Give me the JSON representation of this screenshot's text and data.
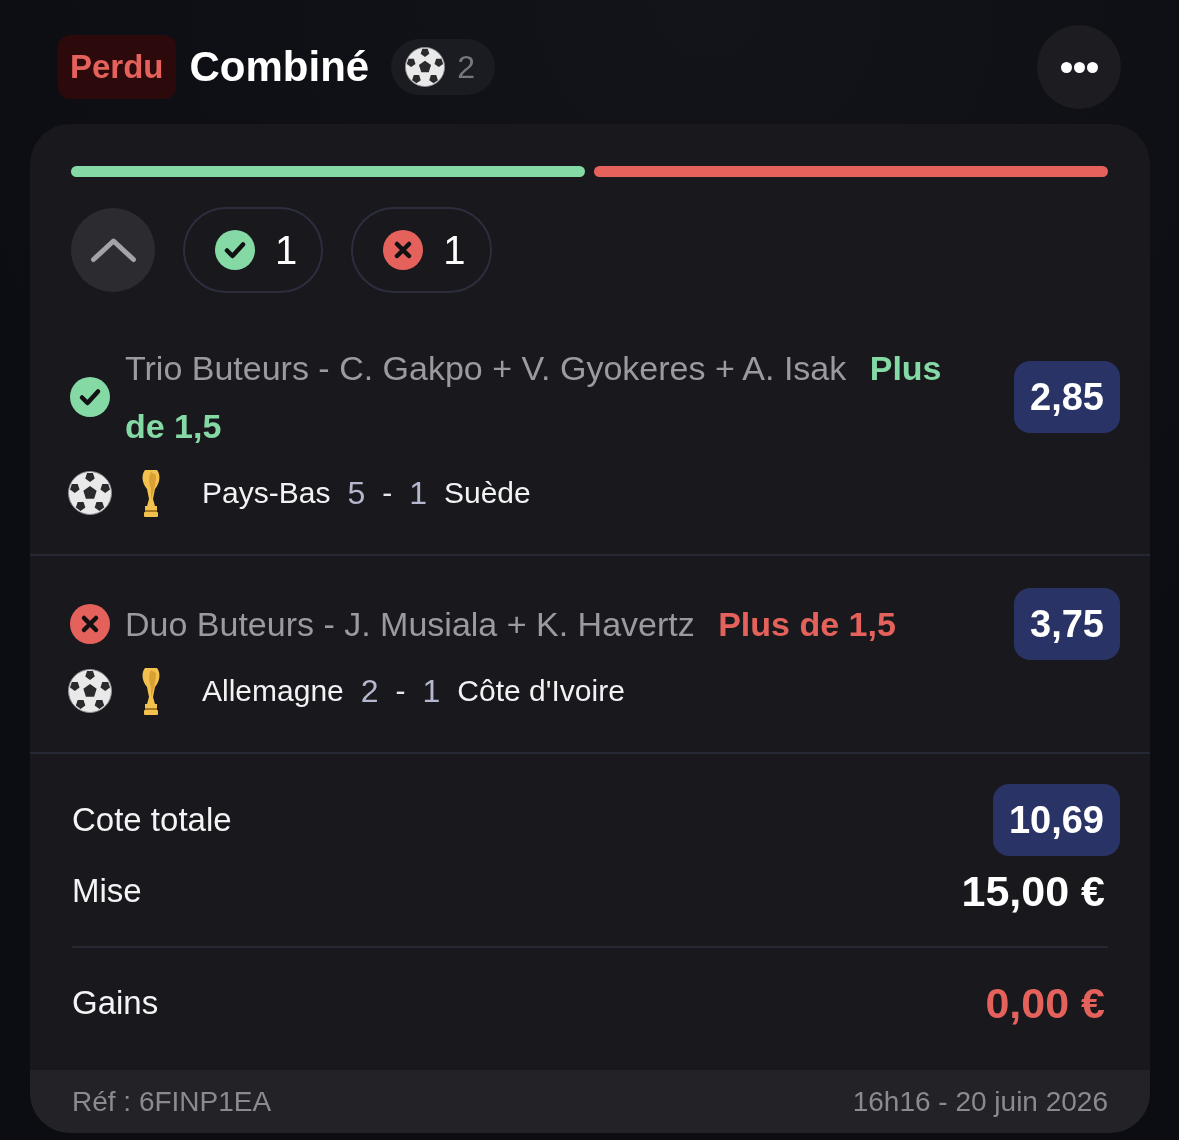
{
  "header": {
    "status": {
      "label": "Perdu",
      "kind": "lost"
    },
    "title": "Combiné",
    "sport_count": "2"
  },
  "filter_bar": {
    "expanded": true,
    "chips": [
      {
        "kind": "won",
        "count": "1"
      },
      {
        "kind": "lost",
        "count": "1"
      }
    ]
  },
  "selections": [
    {
      "kind": "won",
      "market": "Trio Buteurs - C. Gakpo + V. Gyokeres + A. Isak",
      "pick": "Plus de 1,5",
      "odds": "2,85",
      "match": {
        "home": "Pays-Bas",
        "home_score": "5",
        "separator": "-",
        "away_score": "1",
        "away": "Suède"
      }
    },
    {
      "kind": "lost",
      "market": "Duo Buteurs - J. Musiala + K. Havertz",
      "pick": "Plus de 1,5",
      "odds": "3,75",
      "match": {
        "home": "Allemagne",
        "home_score": "2",
        "separator": "-",
        "away_score": "1",
        "away": "Côte d'Ivoire"
      }
    }
  ],
  "summary": {
    "total_odds": {
      "label": "Cote totale",
      "value": "10,69"
    },
    "stake": {
      "label": "Mise",
      "value": "15,00 €"
    },
    "winnings": {
      "label": "Gains",
      "value": "0,00 €"
    }
  },
  "footer": {
    "reference": "Réf : 6FINP1EA",
    "date": "16h16 - 20 juin 2026"
  }
}
